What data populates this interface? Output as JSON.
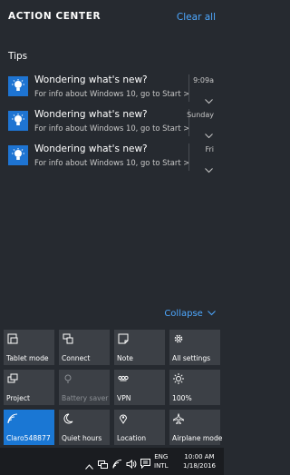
{
  "header": {
    "title": "ACTION CENTER",
    "clear_all": "Clear all"
  },
  "tips": {
    "title": "Tips",
    "notifications": [
      {
        "title": "Wondering what's new?",
        "body": "For info about Windows 10, go to Start >",
        "time": "9:09a"
      },
      {
        "title": "Wondering what's new?",
        "body": "For info about Windows 10, go to Start >",
        "time": "Sunday"
      },
      {
        "title": "Wondering what's new?",
        "body": "For info about Windows 10, go to Start >",
        "time": "Fri"
      }
    ]
  },
  "collapse_label": "Collapse",
  "quick_actions": [
    {
      "label": "Tablet mode",
      "icon": "tablet-mode-icon",
      "state": "off"
    },
    {
      "label": "Connect",
      "icon": "connect-icon",
      "state": "off"
    },
    {
      "label": "Note",
      "icon": "note-icon",
      "state": "off"
    },
    {
      "label": "All settings",
      "icon": "gear-icon",
      "state": "off"
    },
    {
      "label": "Project",
      "icon": "project-icon",
      "state": "off"
    },
    {
      "label": "Battery saver",
      "icon": "battery-saver-icon",
      "state": "disabled"
    },
    {
      "label": "VPN",
      "icon": "vpn-icon",
      "state": "off"
    },
    {
      "label": "100%",
      "icon": "brightness-icon",
      "state": "off"
    },
    {
      "label": "Claro548877",
      "icon": "wifi-icon",
      "state": "on"
    },
    {
      "label": "Quiet hours",
      "icon": "moon-icon",
      "state": "off"
    },
    {
      "label": "Location",
      "icon": "location-icon",
      "state": "off"
    },
    {
      "label": "Airplane mode",
      "icon": "airplane-icon",
      "state": "off"
    }
  ],
  "taskbar": {
    "language": "ENG",
    "layout": "INTL",
    "time": "10:00 AM",
    "date": "1/18/2016"
  },
  "colors": {
    "accent": "#1a77d4",
    "link": "#4ea8ff",
    "background": "#262a30",
    "tile": "#3c4046"
  }
}
